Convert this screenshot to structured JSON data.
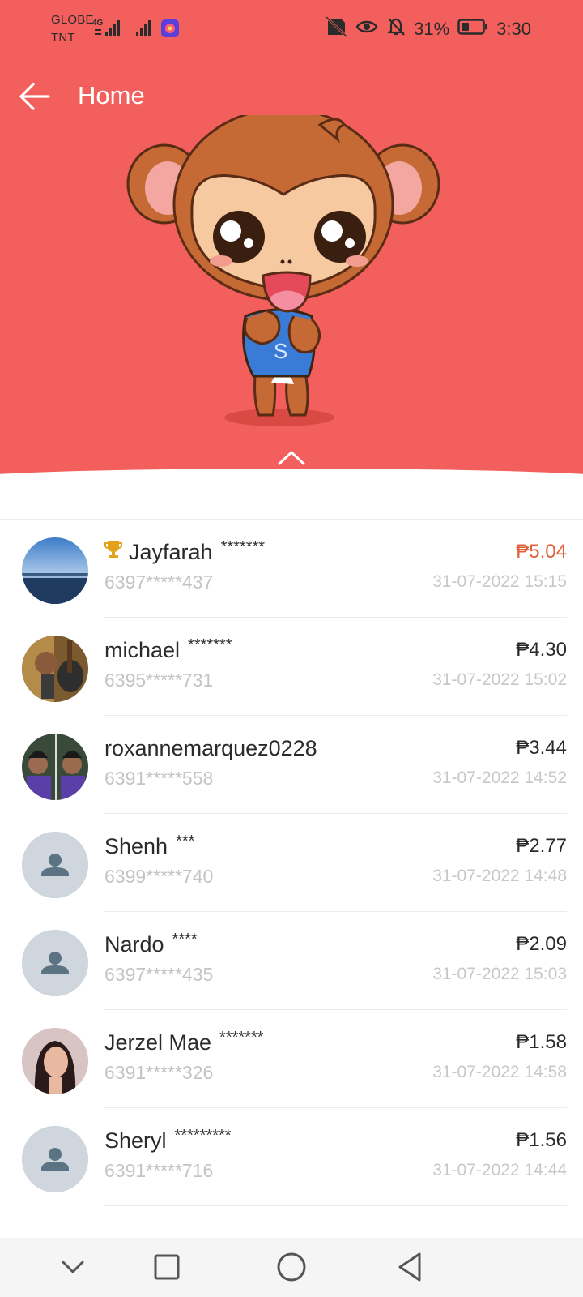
{
  "status_bar": {
    "carrier_top": "GLOBE",
    "carrier_bottom": "TNT",
    "network_badge": "4G",
    "battery_percent": "31%",
    "time": "3:30"
  },
  "appbar": {
    "title": "Home"
  },
  "colors": {
    "header_bg": "#f25f5c",
    "top_amount": "#e0603a",
    "muted_text": "#c4c4c4"
  },
  "list": [
    {
      "name": "Jayfarah",
      "mask": "*******",
      "phone": "6397*****437",
      "amount": "₱5.04",
      "time": "31-07-2022 15:15",
      "trophy": true,
      "avatar": "photo-sea"
    },
    {
      "name": "michael",
      "mask": "*******",
      "phone": "6395*****731",
      "amount": "₱4.30",
      "time": "31-07-2022 15:02",
      "trophy": false,
      "avatar": "photo-guitar"
    },
    {
      "name": "roxannemarquez0228",
      "mask": "",
      "phone": "6391*****558",
      "amount": "₱3.44",
      "time": "31-07-2022 14:52",
      "trophy": false,
      "avatar": "photo-pair"
    },
    {
      "name": "Shenh",
      "mask": "***",
      "phone": "6399*****740",
      "amount": "₱2.77",
      "time": "31-07-2022 14:48",
      "trophy": false,
      "avatar": "default"
    },
    {
      "name": "Nardo",
      "mask": "****",
      "phone": "6397*****435",
      "amount": "₱2.09",
      "time": "31-07-2022 15:03",
      "trophy": false,
      "avatar": "default"
    },
    {
      "name": "Jerzel Mae",
      "mask": "*******",
      "phone": "6391*****326",
      "amount": "₱1.58",
      "time": "31-07-2022 14:58",
      "trophy": false,
      "avatar": "photo-woman"
    },
    {
      "name": "Sheryl",
      "mask": "*********",
      "phone": "6391*****716",
      "amount": "₱1.56",
      "time": "31-07-2022 14:44",
      "trophy": false,
      "avatar": "default"
    }
  ],
  "navbar": {
    "icons": [
      "chevron-down-icon",
      "square-icon",
      "circle-home-icon",
      "triangle-back-icon"
    ]
  }
}
